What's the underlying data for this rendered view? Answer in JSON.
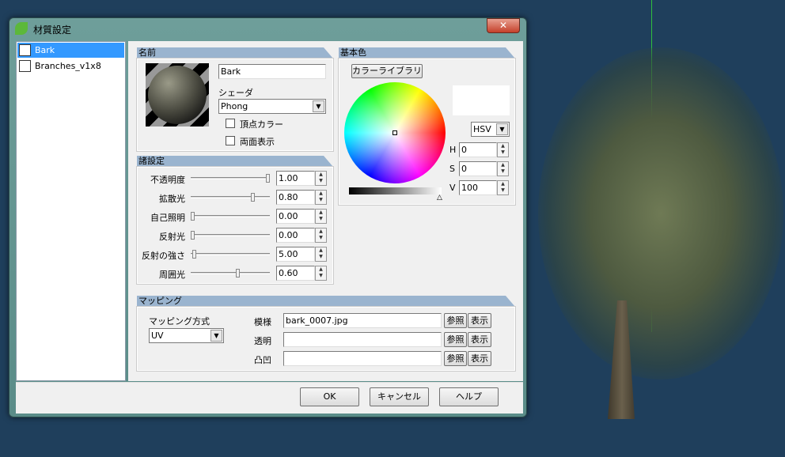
{
  "dialog": {
    "title": "材質設定",
    "close_label": "✕"
  },
  "materials": [
    {
      "name": "Bark",
      "selected": true
    },
    {
      "name": "Branches_v1x8",
      "selected": false
    }
  ],
  "name_group": {
    "header": "名前",
    "name_value": "Bark",
    "shader_label": "シェーダ",
    "shader_value": "Phong",
    "vertex_color_label": "頂点カラー",
    "vertex_color_checked": false,
    "double_sided_label": "両面表示",
    "double_sided_checked": false
  },
  "settings": {
    "header": "諸設定",
    "rows": [
      {
        "label": "不透明度",
        "value": "1.00",
        "fraction": 1.0
      },
      {
        "label": "拡散光",
        "value": "0.80",
        "fraction": 0.8
      },
      {
        "label": "自己照明",
        "value": "0.00",
        "fraction": 0.0
      },
      {
        "label": "反射光",
        "value": "0.00",
        "fraction": 0.0
      },
      {
        "label": "反射の強さ",
        "value": "5.00",
        "fraction": 0.02
      },
      {
        "label": "周囲光",
        "value": "0.60",
        "fraction": 0.6
      }
    ]
  },
  "color": {
    "header": "基本色",
    "library_button": "カラーライブラリ",
    "mode": "HSV",
    "h_label": "H",
    "h": "0",
    "s_label": "S",
    "s": "0",
    "v_label": "V",
    "v": "100",
    "swatch": "#ffffff"
  },
  "mapping": {
    "header": "マッピング",
    "method_label": "マッピング方式",
    "method_value": "UV",
    "rows": [
      {
        "label": "模様",
        "file": "bark_0007.jpg",
        "browse": "参照",
        "show": "表示"
      },
      {
        "label": "透明",
        "file": "",
        "browse": "参照",
        "show": "表示"
      },
      {
        "label": "凸凹",
        "file": "",
        "browse": "参照",
        "show": "表示"
      }
    ]
  },
  "buttons": {
    "ok": "OK",
    "cancel": "キャンセル",
    "help": "ヘルプ"
  }
}
